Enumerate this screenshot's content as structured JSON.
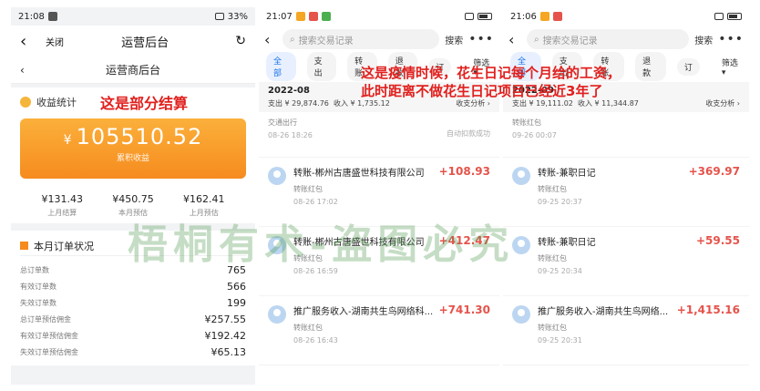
{
  "phone1": {
    "status_time": "21:08",
    "status_battery": "33%",
    "nav_close": "关闭",
    "nav_title": "运营后台",
    "sub_title": "运营商后台",
    "earnings_label": "收益统计",
    "annotation": "这是部分结算",
    "total_amount": "105510.52",
    "currency": "¥",
    "total_label": "累积收益",
    "stats": [
      {
        "value": "¥131.43",
        "label": "上月结算"
      },
      {
        "value": "¥450.75",
        "label": "本月预估"
      },
      {
        "value": "¥162.41",
        "label": "上月预估"
      }
    ],
    "orders_title": "本月订单状况",
    "orders": [
      {
        "label": "总订单数",
        "value": "765"
      },
      {
        "label": "有效订单数",
        "value": "566"
      },
      {
        "label": "失效订单数",
        "value": "199"
      },
      {
        "label": "总订单预估佣金",
        "value": "¥257.55"
      },
      {
        "label": "有效订单预估佣金",
        "value": "¥192.42"
      },
      {
        "label": "失效订单预估佣金",
        "value": "¥65.13"
      }
    ]
  },
  "phone2": {
    "status_time": "21:07",
    "search_placeholder": "搜索交易记录",
    "search_button": "搜索",
    "tabs": [
      "全部",
      "支出",
      "转账",
      "退款",
      "订"
    ],
    "filter": "筛选",
    "month": "2022-08",
    "expense": "支出 ¥ 29,874.76",
    "income": "收入 ¥ 1,735.12",
    "analysis": "收支分析",
    "partial": {
      "sub": "交通出行",
      "time": "08-26 18:26",
      "status": "自动扣款成功"
    },
    "transactions": [
      {
        "name": "转账-郴州古唐盛世科技有限公司",
        "amount": "+108.93",
        "sub": "转账红包",
        "time": "08-26 17:02"
      },
      {
        "name": "转账-郴州古唐盛世科技有限公司",
        "amount": "+412.47",
        "sub": "转账红包",
        "time": "08-26 16:59"
      },
      {
        "name": "推广服务收入-湖南共生鸟网络科...",
        "amount": "+741.30",
        "sub": "转账红包",
        "time": "08-26 16:43"
      }
    ]
  },
  "phone3": {
    "status_time": "21:06",
    "search_placeholder": "搜索交易记录",
    "search_button": "搜索",
    "tabs": [
      "全部",
      "支出",
      "转账",
      "退款",
      "订"
    ],
    "filter": "筛选",
    "month": "2022-09",
    "expense": "支出 ¥ 19,111.02",
    "income": "收入 ¥ 11,344.87",
    "analysis": "收支分析",
    "partial": {
      "sub": "转账红包",
      "time": "09-26 00:07"
    },
    "transactions": [
      {
        "name": "转账-兼职日记",
        "amount": "+369.97",
        "sub": "转账红包",
        "time": "09-25 20:37"
      },
      {
        "name": "转账-兼职日记",
        "amount": "+59.55",
        "sub": "转账红包",
        "time": "09-25 20:34"
      },
      {
        "name": "推广服务收入-湖南共生鸟网络...",
        "amount": "+1,415.16",
        "sub": "转账红包",
        "time": "09-25 20:31"
      }
    ]
  },
  "annotation_line1": "这是疫情时候，花生日记每个月给的工资，",
  "annotation_line2": "此时距离不做花生日记项目已经近3年了",
  "watermark": "梧桐有术-盗图必究"
}
